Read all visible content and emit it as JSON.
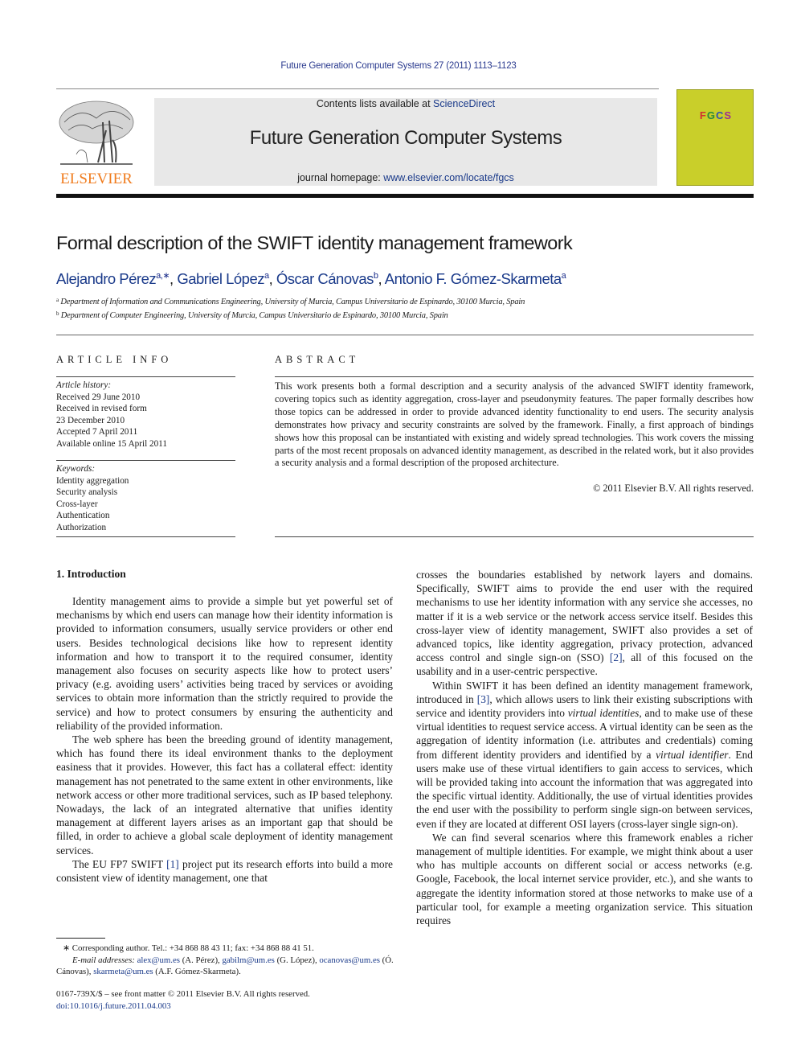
{
  "header": {
    "citation": "Future Generation Computer Systems 27 (2011) 1113–1123",
    "publisher_logo": "ELSEVIER",
    "contents_prefix": "Contents lists available at ",
    "contents_link": "ScienceDirect",
    "journal_name": "Future Generation Computer Systems",
    "homepage_prefix": "journal homepage: ",
    "homepage_link": "www.elsevier.com/locate/fgcs",
    "cover_label": "FGCS"
  },
  "article": {
    "title": "Formal description of the SWIFT identity management framework",
    "authors": [
      {
        "name": "Alejandro Pérez",
        "sup": "a,∗"
      },
      {
        "name": "Gabriel López",
        "sup": "a"
      },
      {
        "name": "Óscar Cánovas",
        "sup": "b"
      },
      {
        "name": "Antonio F. Gómez-Skarmeta",
        "sup": "a"
      }
    ],
    "affiliations": [
      {
        "mark": "a",
        "text": "Department of Information and Communications Engineering, University of Murcia, Campus Universitario de Espinardo, 30100 Murcia, Spain"
      },
      {
        "mark": "b",
        "text": "Department of Computer Engineering, University of Murcia, Campus Universitario de Espinardo, 30100 Murcia, Spain"
      }
    ]
  },
  "article_info": {
    "caption": "ARTICLE INFO",
    "history_label": "Article history:",
    "history": [
      "Received 29 June 2010",
      "Received in revised form",
      "23 December 2010",
      "Accepted 7 April 2011",
      "Available online 15 April 2011"
    ],
    "keywords_label": "Keywords:",
    "keywords": [
      "Identity aggregation",
      "Security analysis",
      "Cross-layer",
      "Authentication",
      "Authorization"
    ]
  },
  "abstract": {
    "caption": "ABSTRACT",
    "text": "This work presents both a formal description and a security analysis of the advanced SWIFT identity framework, covering topics such as identity aggregation, cross-layer and pseudonymity features. The paper formally describes how those topics can be addressed in order to provide advanced identity functionality to end users. The security analysis demonstrates how privacy and security constraints are solved by the framework. Finally, a first approach of bindings shows how this proposal can be instantiated with existing and widely spread technologies. This work covers the missing parts of the most recent proposals on advanced identity management, as described in the related work, but it also provides a security analysis and a formal description of the proposed architecture.",
    "copyright": "© 2011 Elsevier B.V. All rights reserved."
  },
  "introduction": {
    "heading": "1.  Introduction",
    "p1": "Identity management aims to provide a simple but yet powerful set of mechanisms by which end users can manage how their identity information is provided to information consumers, usually service providers or other end users. Besides technological decisions like how to represent identity information and how to transport it to the required consumer, identity management also focuses on security aspects like how to protect users’ privacy (e.g. avoiding users’ activities being traced by services or avoiding services to obtain more information than the strictly required to provide the service) and how to protect consumers by ensuring the authenticity and reliability of the provided information.",
    "p2": "The web sphere has been the breeding ground of identity management, which has found there its ideal environment thanks to the deployment easiness that it provides. However, this fact has a collateral effect: identity management has not penetrated to the same extent in other environments, like network access or other more traditional services, such as IP based telephony. Nowadays, the lack of an integrated alternative that unifies identity management at different layers arises as an important gap that should be filled, in order to achieve a global scale deployment of identity management services.",
    "p3_a": "The EU FP7 SWIFT ",
    "p3_ref": "[1]",
    "p3_b": " project put its research efforts into build a more consistent view of identity management, one that",
    "r1_a": "crosses the boundaries established by network layers and domains. Specifically, SWIFT aims to provide the end user with the required mechanisms to use her identity information with any service she accesses, no matter if it is a web service or the network access service itself. Besides this cross-layer view of identity management, SWIFT also provides a set of advanced topics, like identity aggregation, privacy protection, advanced access control and single sign-on (SSO) ",
    "r1_ref": "[2]",
    "r1_b": ", all of this focused on the usability and in a user-centric perspective.",
    "r2_a": "Within SWIFT it has been defined an identity management framework, introduced in ",
    "r2_ref": "[3]",
    "r2_b": ", which allows users to link their existing subscriptions with service and identity providers into ",
    "r2_em1": "virtual identities",
    "r2_c": ", and to make use of these virtual identities to request service access. A virtual identity can be seen as the aggregation of identity information (i.e. attributes and credentials) coming from different identity providers and identified by a ",
    "r2_em2": "virtual identifier",
    "r2_d": ". End users make use of these virtual identifiers to gain access to services, which will be provided taking into account the information that was aggregated into the specific virtual identity. Additionally, the use of virtual identities provides the end user with the possibility to perform single sign-on between services, even if they are located at different OSI layers (cross-layer single sign-on).",
    "r3": "We can find several scenarios where this framework enables a richer management of multiple identities. For example, we might think about a user who has multiple accounts on different social or access networks (e.g. Google, Facebook, the local internet service provider, etc.), and she wants to aggregate the identity information stored at those networks to make use of a particular tool, for example a meeting organization service. This situation requires"
  },
  "footnotes": {
    "star": "∗",
    "corresponding": "Corresponding author. Tel.: +34 868 88 43 11; fax: +34 868 88 41 51.",
    "email_label": "E-mail addresses:",
    "emails": [
      {
        "addr": "alex@um.es",
        "who": " (A. Pérez), "
      },
      {
        "addr": "gabilm@um.es",
        "who": " (G. López),"
      },
      {
        "addr": "ocanovas@um.es",
        "who": " (Ó. Cánovas), "
      },
      {
        "addr": "skarmeta@um.es",
        "who": " (A.F. Gómez-Skarmeta)."
      }
    ],
    "front_matter": "0167-739X/$ – see front matter © 2011 Elsevier B.V. All rights reserved.",
    "doi": "doi:10.1016/j.future.2011.04.003"
  },
  "colors": {
    "link": "#1a3a8a",
    "elsevier_orange": "#f07c1e",
    "cover_yellow": "#c9cf2a",
    "banner_gray": "#e8e8e8"
  }
}
